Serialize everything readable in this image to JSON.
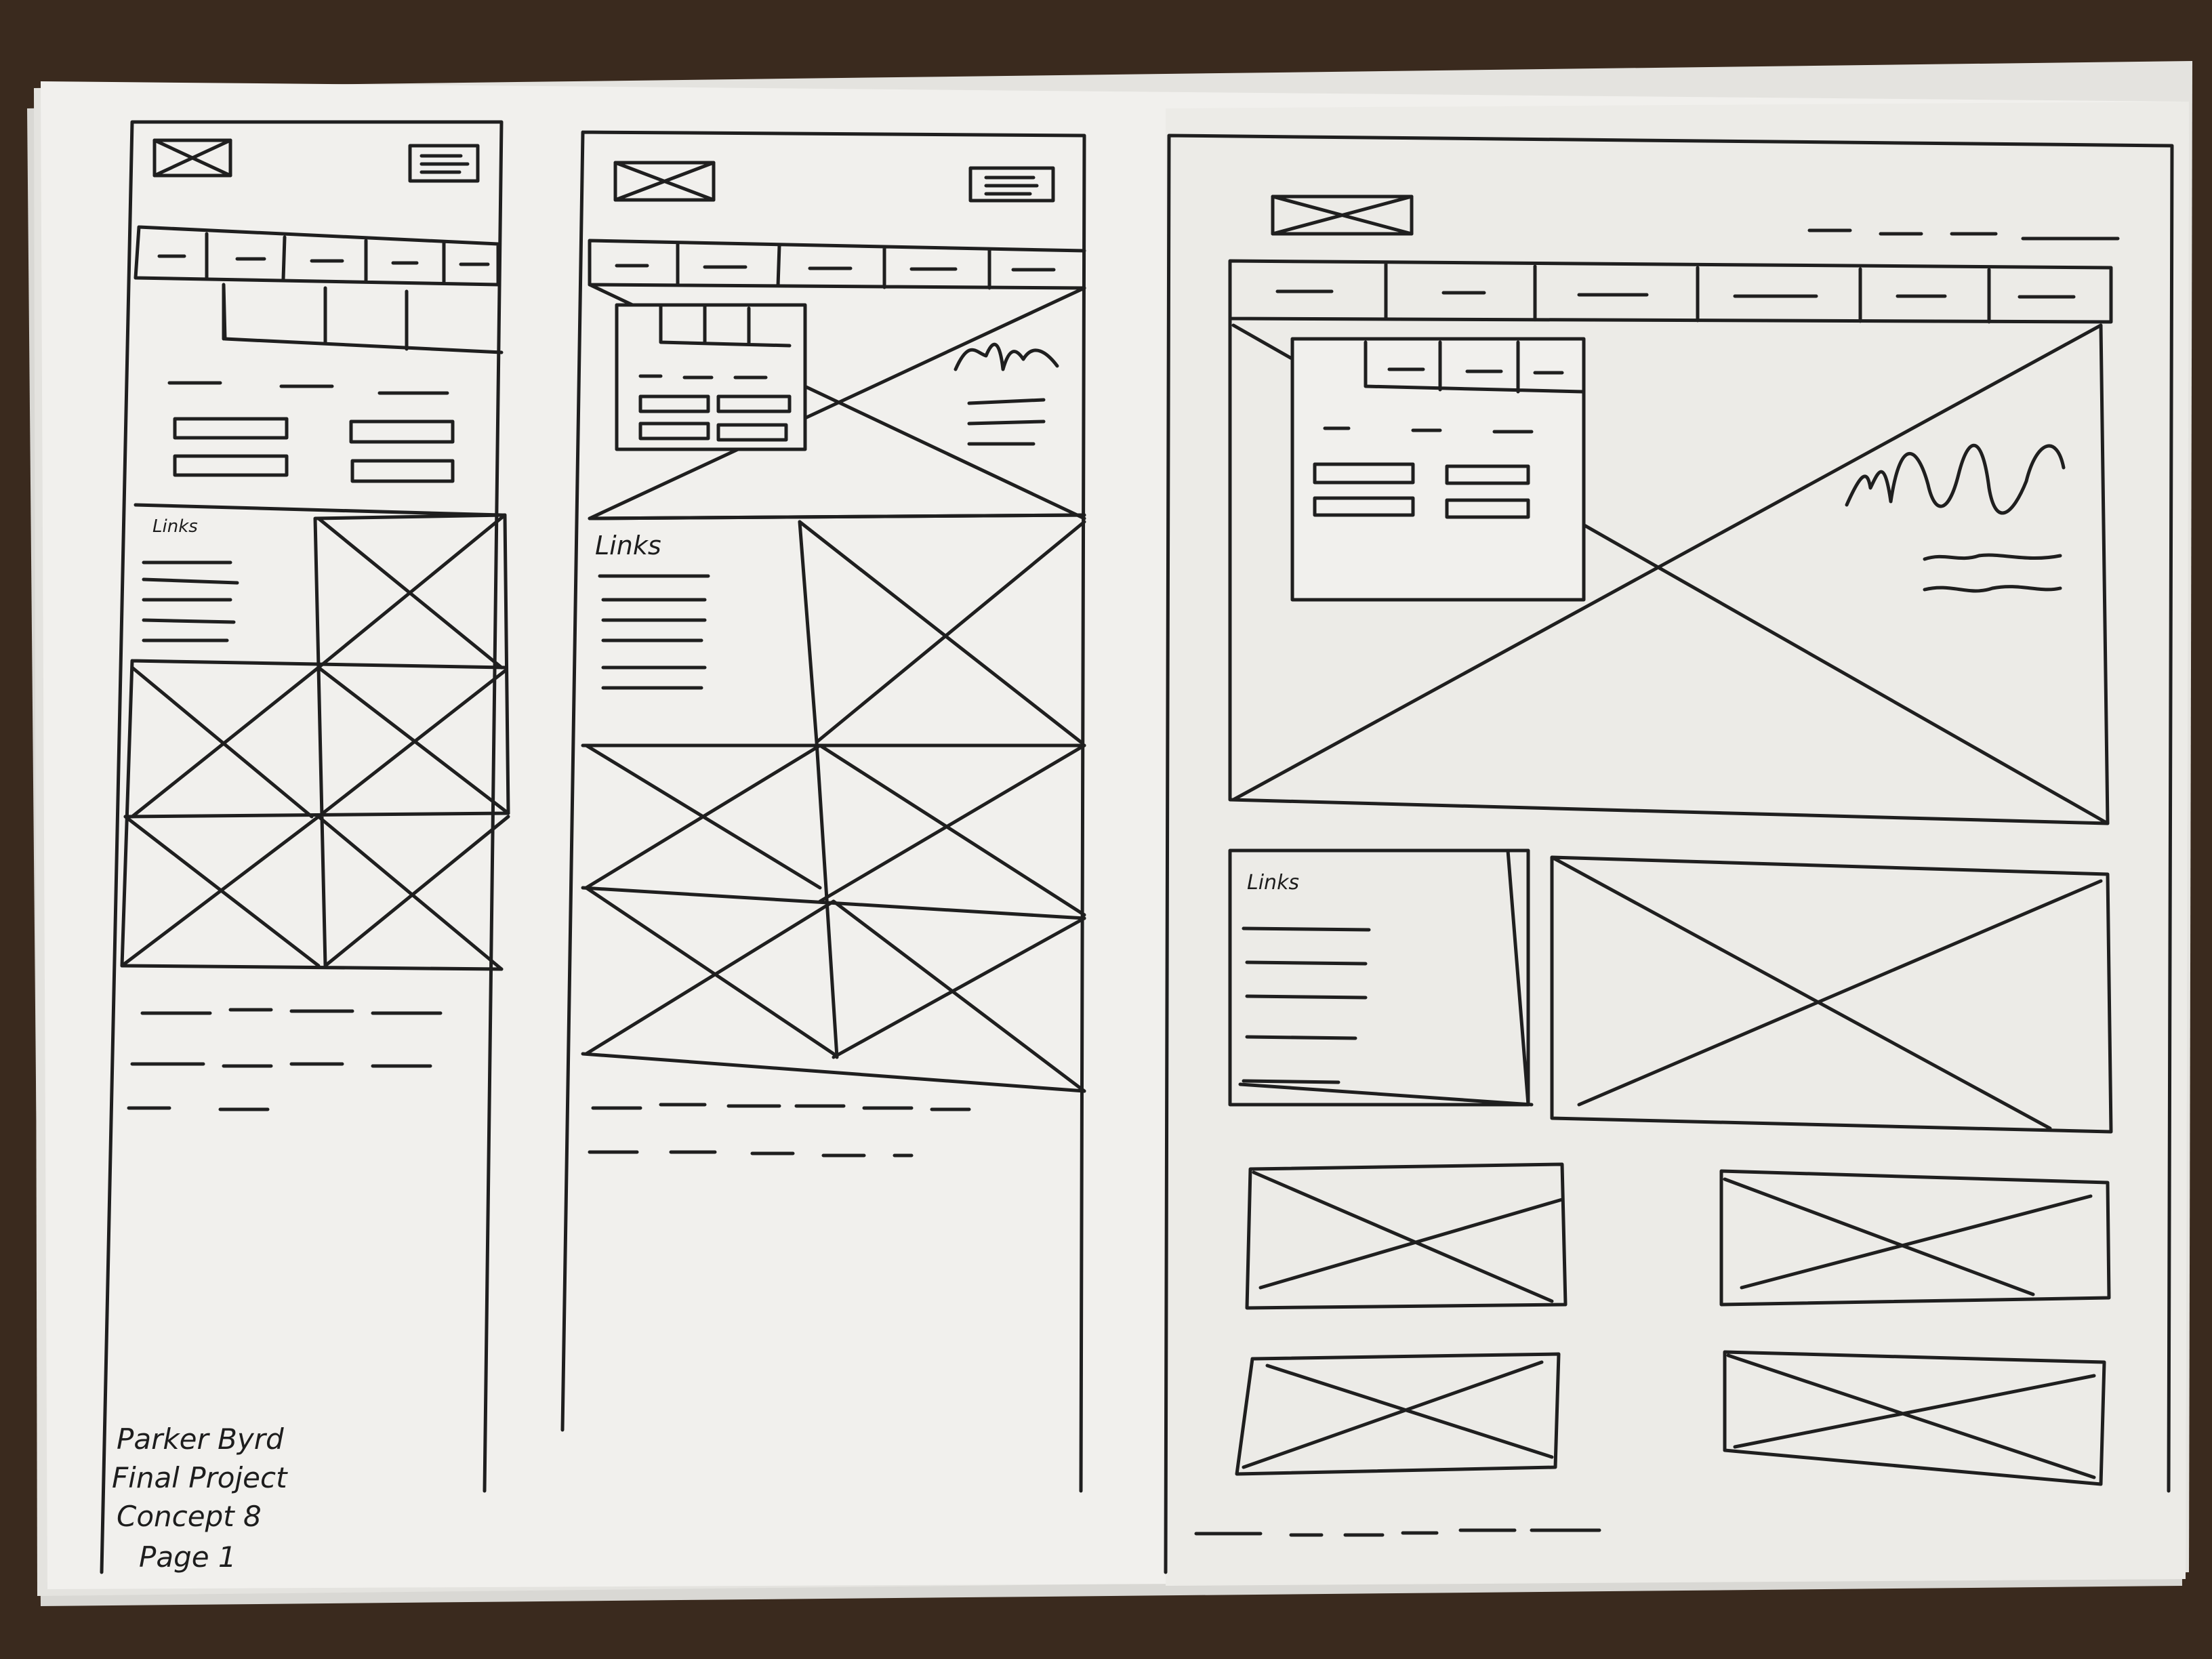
{
  "colors": {
    "table": "#3a2a1e",
    "paper": "#f1f0ed",
    "paper_shadow": "#d9d8d4",
    "ink": "#1f1f1f"
  },
  "wireframes": {
    "mobile": {
      "links_label": "Links"
    },
    "tablet": {
      "links_label": "Links"
    },
    "desktop": {
      "links_label": "Links"
    }
  },
  "signature": {
    "line1": "Parker Byrd",
    "line2": "Final Project",
    "line3": "Concept 8",
    "line4": "Page 1"
  }
}
